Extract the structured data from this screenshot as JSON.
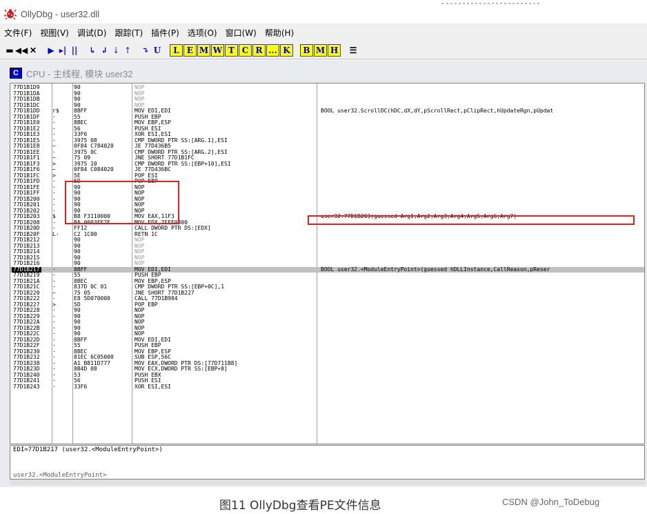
{
  "window": {
    "title": "OllyDbg - user32.dll",
    "icon": "bug-icon"
  },
  "menu": [
    "文件(F)",
    "视图(V)",
    "调试(D)",
    "跟踪(T)",
    "插件(P)",
    "选项(O)",
    "窗口(W)",
    "帮助(H)"
  ],
  "toolbar": {
    "buttons": [
      {
        "label": "▬",
        "icon": "open-icon",
        "style": "blk"
      },
      {
        "label": "◀◀",
        "icon": "restart-icon",
        "style": "blk"
      },
      {
        "label": "✕",
        "icon": "close-icon",
        "style": "blk"
      },
      {
        "label": "",
        "icon": "separator",
        "style": "sep"
      },
      {
        "label": "▶",
        "icon": "run-icon",
        "style": "blue"
      },
      {
        "label": "▸|",
        "icon": "run-thread-icon",
        "style": "blue"
      },
      {
        "label": "||",
        "icon": "pause-icon",
        "style": "blue"
      },
      {
        "label": "",
        "icon": "separator",
        "style": "sep"
      },
      {
        "label": "↳",
        "icon": "step-into-icon",
        "style": "blue"
      },
      {
        "label": "↲",
        "icon": "step-over-icon",
        "style": "blue"
      },
      {
        "label": "⇣",
        "icon": "trace-into-icon",
        "style": "blue"
      },
      {
        "label": "⇡",
        "icon": "trace-over-icon",
        "style": "blue"
      },
      {
        "label": "",
        "icon": "separator",
        "style": "sep"
      },
      {
        "label": "⤵",
        "icon": "execute-till-return-icon",
        "style": "blue"
      },
      {
        "label": "U",
        "icon": "execute-till-user-icon",
        "style": "blue"
      },
      {
        "label": "",
        "icon": "separator",
        "style": "sep"
      },
      {
        "label": "L",
        "icon": "log-window-key",
        "style": "key"
      },
      {
        "label": "E",
        "icon": "modules-window-key",
        "style": "key"
      },
      {
        "label": "M",
        "icon": "memory-window-key",
        "style": "key"
      },
      {
        "label": "W",
        "icon": "windows-window-key",
        "style": "key"
      },
      {
        "label": "T",
        "icon": "threads-window-key",
        "style": "key"
      },
      {
        "label": "C",
        "icon": "cpu-window-key",
        "style": "key"
      },
      {
        "label": "R",
        "icon": "references-window-key",
        "style": "key"
      },
      {
        "label": "...",
        "icon": "run-trace-key",
        "style": "key"
      },
      {
        "label": "K",
        "icon": "call-stack-key",
        "style": "key"
      },
      {
        "label": "",
        "icon": "separator",
        "style": "sep"
      },
      {
        "label": "B",
        "icon": "breakpoints-key",
        "style": "key"
      },
      {
        "label": "M",
        "icon": "memory-breakpoints-key",
        "style": "key"
      },
      {
        "label": "H",
        "icon": "hardware-breakpoints-key",
        "style": "key"
      },
      {
        "label": "",
        "icon": "separator",
        "style": "sep"
      },
      {
        "label": "☰",
        "icon": "list-icon",
        "style": "blk"
      }
    ]
  },
  "cpu_window": {
    "badge": "C",
    "title": "CPU - 主线程, 模块 user32"
  },
  "disasm": [
    {
      "addr": "77D1B1D9",
      "mark": "",
      "hex": "90",
      "dis": "NOP",
      "com": "",
      "nop": true
    },
    {
      "addr": "77D1B1DA",
      "mark": "",
      "hex": "90",
      "dis": "NOP",
      "com": "",
      "nop": true
    },
    {
      "addr": "77D1B1DB",
      "mark": "",
      "hex": "90",
      "dis": "NOP",
      "com": "",
      "nop": true
    },
    {
      "addr": "77D1B1DC",
      "mark": "",
      "hex": "90",
      "dis": "NOP",
      "com": "",
      "nop": true
    },
    {
      "addr": "77D1B1DD",
      "mark": "r$",
      "hex": "8BFF",
      "dis": "MOV EDI,EDI",
      "com": "BOOL user32.ScrollDC(hDC,dX,dY,pScrollRect,pClipRect,hUpdateRgn,pUpdat"
    },
    {
      "addr": "77D1B1DF",
      "mark": "·",
      "hex": "55",
      "dis": "PUSH EBP",
      "com": ""
    },
    {
      "addr": "77D1B1E0",
      "mark": "·",
      "hex": "8BEC",
      "dis": "MOV EBP,ESP",
      "com": ""
    },
    {
      "addr": "77D1B1E2",
      "mark": "·",
      "hex": "56",
      "dis": "PUSH ESI",
      "com": ""
    },
    {
      "addr": "77D1B1E3",
      "mark": "·",
      "hex": "33F6",
      "dis": "XOR ESI,ESI",
      "com": ""
    },
    {
      "addr": "77D1B1E5",
      "mark": "·",
      "hex": "3975 08",
      "dis": "CMP DWORD PTR SS:[ARG.1],ESI",
      "com": ""
    },
    {
      "addr": "77D1B1E8",
      "mark": "~",
      "hex": "0F84 C784020",
      "dis": "JE 77D436B5",
      "com": ""
    },
    {
      "addr": "77D1B1EE",
      "mark": "·",
      "hex": "3975 0C",
      "dis": "CMP DWORD PTR SS:[ARG.2],ESI",
      "com": ""
    },
    {
      "addr": "77D1B1F1",
      "mark": "~",
      "hex": "75 09",
      "dis": "JNE SHORT 77D1B1FC",
      "com": ""
    },
    {
      "addr": "77D1B1F3",
      "mark": ">",
      "hex": "3975 10",
      "dis": "CMP DWORD PTR SS:[EBP+10],ESI",
      "com": ""
    },
    {
      "addr": "77D1B1F6",
      "mark": "~",
      "hex": "0F84 C084020",
      "dis": "JE 77D436BC",
      "com": ""
    },
    {
      "addr": "77D1B1FC",
      "mark": ">",
      "hex": "5E",
      "dis": "POP ESI",
      "com": ""
    },
    {
      "addr": "77D1B1FD",
      "mark": "·",
      "hex": "5D",
      "dis": "POP EBP",
      "com": ""
    },
    {
      "addr": "77D1B1FE",
      "mark": "·",
      "hex": "90",
      "dis": "NOP",
      "com": ""
    },
    {
      "addr": "77D1B1FF",
      "mark": "·",
      "hex": "90",
      "dis": "NOP",
      "com": ""
    },
    {
      "addr": "77D1B200",
      "mark": "·",
      "hex": "90",
      "dis": "NOP",
      "com": ""
    },
    {
      "addr": "77D1B201",
      "mark": "·",
      "hex": "90",
      "dis": "NOP",
      "com": ""
    },
    {
      "addr": "77D1B202",
      "mark": "·",
      "hex": "90",
      "dis": "NOP",
      "com": ""
    },
    {
      "addr": "77D1B203",
      "mark": "$",
      "hex": "B8 F3110000",
      "dis": "MOV EAX,11F3",
      "com": "user32.77D1B203(guessed Arg1,Arg2,Arg3,Arg4,Arg5,Arg6,Arg7)"
    },
    {
      "addr": "77D1B208",
      "mark": "·",
      "hex": "BA 0003FE7F",
      "dis": "MOV EDX,7FFE0300",
      "com": ""
    },
    {
      "addr": "77D1B20D",
      "mark": "·",
      "hex": "FF12",
      "dis": "CALL DWORD PTR DS:[EDX]",
      "com": ""
    },
    {
      "addr": "77D1B20F",
      "mark": "L·",
      "hex": "C2 1C00",
      "dis": "RETN 1C",
      "com": ""
    },
    {
      "addr": "77D1B212",
      "mark": "",
      "hex": "90",
      "dis": "NOP",
      "com": "",
      "nop": true
    },
    {
      "addr": "77D1B213",
      "mark": "",
      "hex": "90",
      "dis": "NOP",
      "com": "",
      "nop": true
    },
    {
      "addr": "77D1B214",
      "mark": "",
      "hex": "90",
      "dis": "NOP",
      "com": "",
      "nop": true
    },
    {
      "addr": "77D1B215",
      "mark": "",
      "hex": "90",
      "dis": "NOP",
      "com": "",
      "nop": true
    },
    {
      "addr": "77D1B216",
      "mark": "",
      "hex": "90",
      "dis": "NOP",
      "com": "",
      "nop": true
    },
    {
      "addr": "77D1B217",
      "mark": "·",
      "hex": "8BFF",
      "dis": "MOV EDI,EDI",
      "com": "BOOL user32.<ModuleEntryPoint>(guessed hDLLInstance,CallReason,pReser",
      "sel": true
    },
    {
      "addr": "77D1B219",
      "mark": "·",
      "hex": "55",
      "dis": "PUSH EBP",
      "com": ""
    },
    {
      "addr": "77D1B21A",
      "mark": "·",
      "hex": "8BEC",
      "dis": "MOV EBP,ESP",
      "com": ""
    },
    {
      "addr": "77D1B21C",
      "mark": "·",
      "hex": "837D 0C 01",
      "dis": "CMP DWORD PTR SS:[EBP+0C],1",
      "com": ""
    },
    {
      "addr": "77D1B220",
      "mark": "~",
      "hex": "75 05",
      "dis": "JNE SHORT 77D1B227",
      "com": ""
    },
    {
      "addr": "77D1B222",
      "mark": "·",
      "hex": "E8 5D070000",
      "dis": "CALL 77D1B984",
      "com": ""
    },
    {
      "addr": "77D1B227",
      "mark": ">",
      "hex": "5D",
      "dis": "POP EBP",
      "com": ""
    },
    {
      "addr": "77D1B228",
      "mark": "·",
      "hex": "90",
      "dis": "NOP",
      "com": ""
    },
    {
      "addr": "77D1B229",
      "mark": "·",
      "hex": "90",
      "dis": "NOP",
      "com": ""
    },
    {
      "addr": "77D1B22A",
      "mark": "·",
      "hex": "90",
      "dis": "NOP",
      "com": ""
    },
    {
      "addr": "77D1B22B",
      "mark": "·",
      "hex": "90",
      "dis": "NOP",
      "com": ""
    },
    {
      "addr": "77D1B22C",
      "mark": "·",
      "hex": "90",
      "dis": "NOP",
      "com": ""
    },
    {
      "addr": "77D1B22D",
      "mark": "·",
      "hex": "8BFF",
      "dis": "MOV EDI,EDI",
      "com": ""
    },
    {
      "addr": "77D1B22F",
      "mark": "·",
      "hex": "55",
      "dis": "PUSH EBP",
      "com": ""
    },
    {
      "addr": "77D1B230",
      "mark": "·",
      "hex": "8BEC",
      "dis": "MOV EBP,ESP",
      "com": ""
    },
    {
      "addr": "77D1B232",
      "mark": "·",
      "hex": "81EC 6C05000",
      "dis": "SUB ESP,56C",
      "com": ""
    },
    {
      "addr": "77D1B238",
      "mark": "·",
      "hex": "A1 B811D777",
      "dis": "MOV EAX,DWORD PTR DS:[77D711B8]",
      "com": ""
    },
    {
      "addr": "77D1B23D",
      "mark": "·",
      "hex": "8B4D 08",
      "dis": "MOV ECX,DWORD PTR SS:[EBP+8]",
      "com": ""
    },
    {
      "addr": "77D1B240",
      "mark": "·",
      "hex": "53",
      "dis": "PUSH EBX",
      "com": ""
    },
    {
      "addr": "77D1B241",
      "mark": "·",
      "hex": "56",
      "dis": "PUSH ESI",
      "com": ""
    },
    {
      "addr": "77D1B243",
      "mark": "·",
      "hex": "33F6",
      "dis": "XOR ESI,ESI",
      "com": ""
    }
  ],
  "info": {
    "line1": "EDI=77D1B217 (user32.<ModuleEntryPoint>)",
    "line2": "user32.<ModuleEntryPoint>"
  },
  "caption": {
    "text": "图11 OllyDbg查看PE文件信息",
    "watermark": "CSDN @John_ToDebug"
  },
  "colors": {
    "highlight_box": "#e02020",
    "selected_row": "#c0c0c0",
    "key_button_bg": "#ffff00"
  }
}
